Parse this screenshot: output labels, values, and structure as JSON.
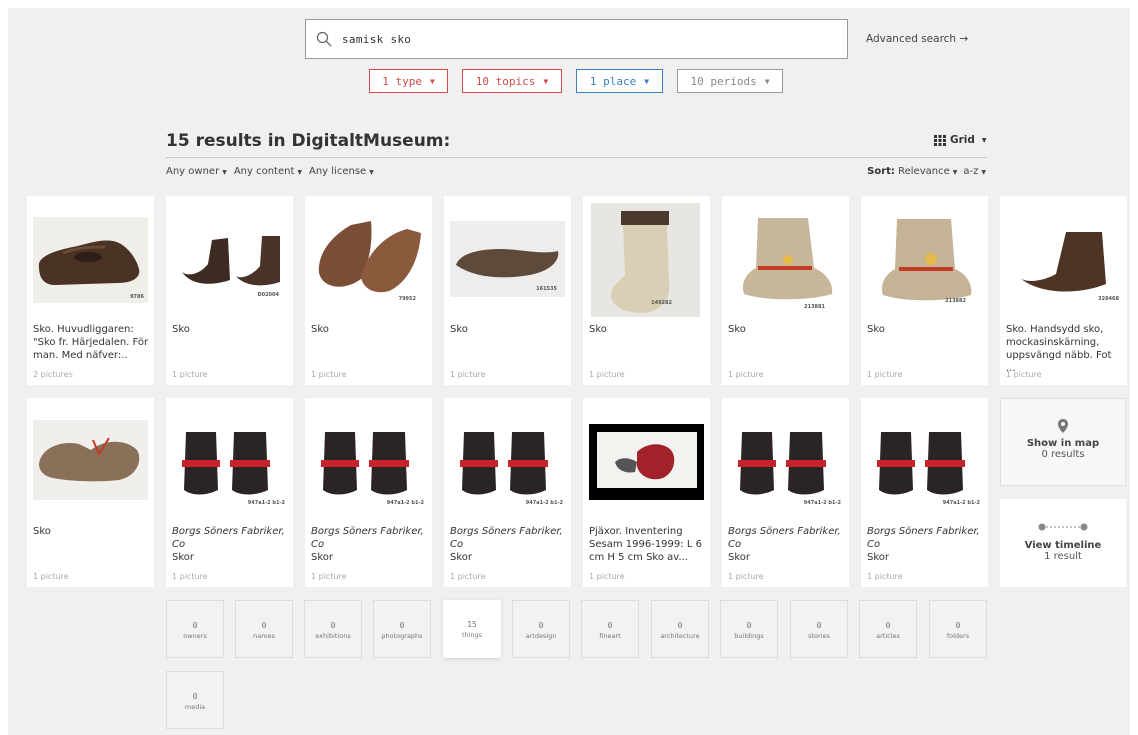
{
  "search": {
    "query": "samisk sko",
    "advanced": "Advanced search →"
  },
  "filters": {
    "type": "1 type",
    "topics": "10 topics",
    "place": "1 place",
    "periods": "10 periods"
  },
  "results_title": "15 results in DigitaltMuseum:",
  "view": "Grid",
  "subfilters": [
    "Any owner",
    "Any content",
    "Any license"
  ],
  "sort": {
    "label": "Sort:",
    "value": "Relevance",
    "order": "a-z"
  },
  "cards": [
    {
      "title": "Sko. Huvudliggaren: \"Sko fr. Härjedalen. För man. Med näfver:..",
      "pictures": "2 pictures",
      "num": "9786"
    },
    {
      "title": "Sko",
      "pictures": "1 picture",
      "num": "D02004"
    },
    {
      "title": "Sko",
      "pictures": "1 picture",
      "num": "79952"
    },
    {
      "title": "Sko",
      "pictures": "1 picture",
      "num": "161535"
    },
    {
      "title": "Sko",
      "pictures": "1 picture",
      "num": "149282"
    },
    {
      "title": "Sko",
      "pictures": "1 picture",
      "num": "213881"
    },
    {
      "title": "Sko",
      "pictures": "1 picture",
      "num": "213882"
    },
    {
      "title": "Sko. Handsydd sko, mockasinskärning, uppsvängd näbb. Fot ...",
      "pictures": "1 picture",
      "num": "326468"
    },
    {
      "title": "Sko",
      "pictures": "1 picture",
      "num": ""
    },
    {
      "title": "Borgs Söners Fabriker, Co",
      "sub": "Skor",
      "pictures": "1 picture",
      "num": "947a1-2 b1-2"
    },
    {
      "title": "Borgs Söners Fabriker, Co",
      "sub": "Skor",
      "pictures": "1 picture",
      "num": "947a1-2 b1-2"
    },
    {
      "title": "Borgs Söners Fabriker, Co",
      "sub": "Skor",
      "pictures": "1 picture",
      "num": "947a1-2 b1-2"
    },
    {
      "title": "Pjäxor. Inventering Sesam 1996-1999: L 6 cm H 5 cm Sko av...",
      "pictures": "1 picture",
      "num": ""
    },
    {
      "title": "Borgs Söners Fabriker, Co",
      "sub": "Skor",
      "pictures": "1 picture",
      "num": "947a1-2 b1-2"
    },
    {
      "title": "Borgs Söners Fabriker, Co",
      "sub": "Skor",
      "pictures": "1 picture",
      "num": "947a1-2 b1-2"
    }
  ],
  "map": {
    "label": "Show in map",
    "count": "0 results"
  },
  "timeline": {
    "label": "View timeline",
    "count": "1 result"
  },
  "categories": [
    {
      "n": "0",
      "label": "owners"
    },
    {
      "n": "0",
      "label": "names"
    },
    {
      "n": "0",
      "label": "exhibitions"
    },
    {
      "n": "0",
      "label": "photographs"
    },
    {
      "n": "15",
      "label": "things"
    },
    {
      "n": "0",
      "label": "artdesign"
    },
    {
      "n": "0",
      "label": "fineart"
    },
    {
      "n": "0",
      "label": "architecture"
    },
    {
      "n": "0",
      "label": "buildings"
    },
    {
      "n": "0",
      "label": "stories"
    },
    {
      "n": "0",
      "label": "articles"
    },
    {
      "n": "0",
      "label": "folders"
    },
    {
      "n": "0",
      "label": "media"
    }
  ],
  "colors": {
    "red": "#d24a4a",
    "blue": "#3a7fc4",
    "bg": "#f0f0f0"
  }
}
